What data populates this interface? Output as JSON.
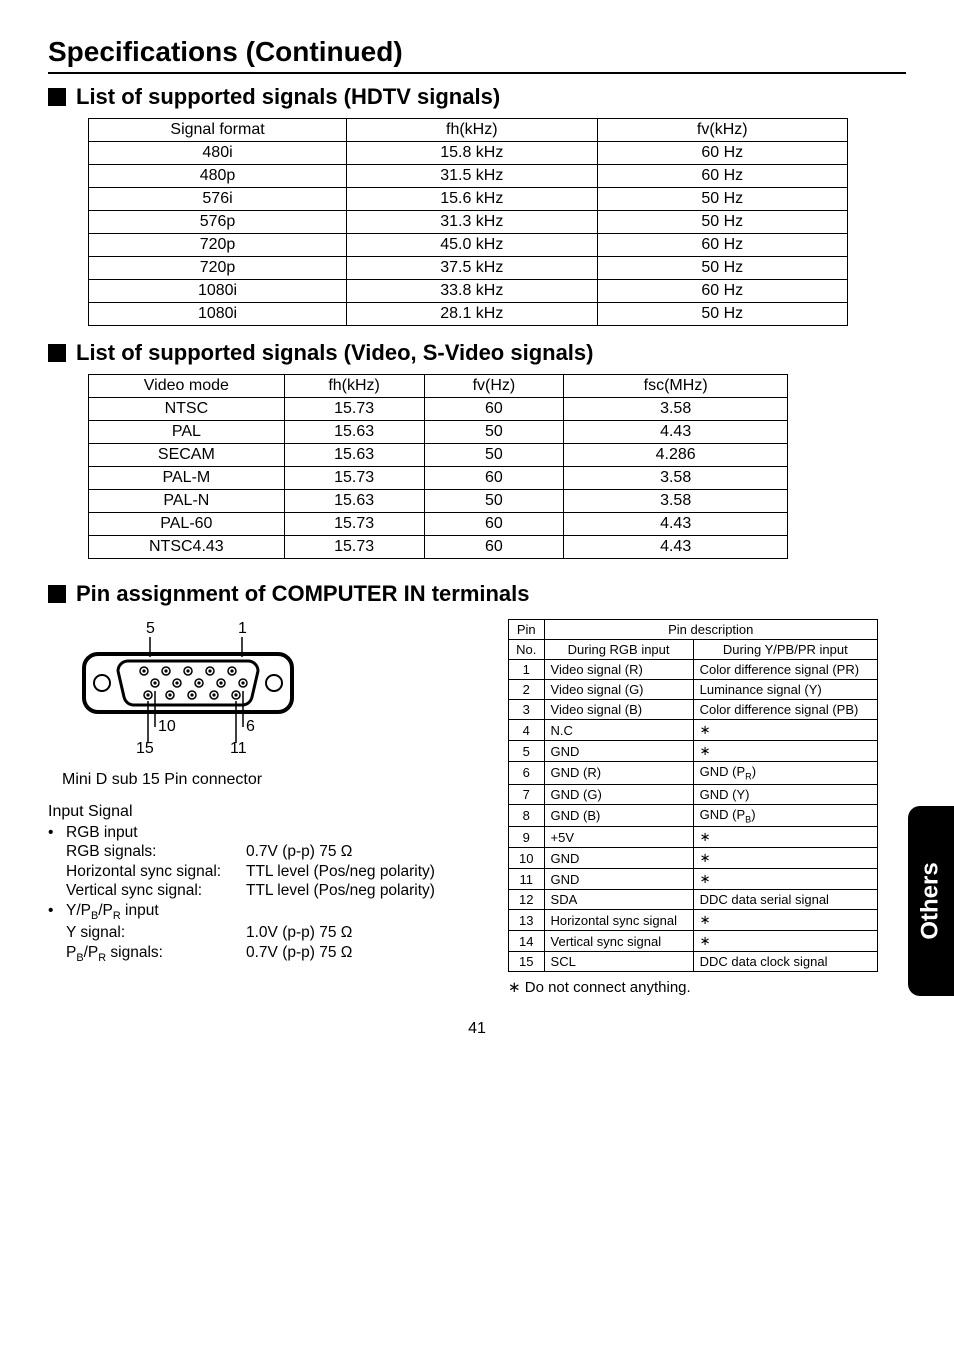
{
  "title": "Specifications (Continued)",
  "sections": {
    "hdtv": {
      "heading": "List of supported signals (HDTV signals)",
      "headers": [
        "Signal format",
        "fh(kHz)",
        "fv(kHz)"
      ],
      "rows": [
        [
          "480i",
          "15.8 kHz",
          "60 Hz"
        ],
        [
          "480p",
          "31.5 kHz",
          "60 Hz"
        ],
        [
          "576i",
          "15.6 kHz",
          "50 Hz"
        ],
        [
          "576p",
          "31.3 kHz",
          "50 Hz"
        ],
        [
          "720p",
          "45.0 kHz",
          "60 Hz"
        ],
        [
          "720p",
          "37.5 kHz",
          "50 Hz"
        ],
        [
          "1080i",
          "33.8 kHz",
          "60 Hz"
        ],
        [
          "1080i",
          "28.1 kHz",
          "50 Hz"
        ]
      ]
    },
    "video": {
      "heading": "List of supported signals (Video, S-Video signals)",
      "headers": [
        "Video mode",
        "fh(kHz)",
        "fv(Hz)",
        "fsc(MHz)"
      ],
      "rows": [
        [
          "NTSC",
          "15.73",
          "60",
          "3.58"
        ],
        [
          "PAL",
          "15.63",
          "50",
          "4.43"
        ],
        [
          "SECAM",
          "15.63",
          "50",
          "4.286"
        ],
        [
          "PAL-M",
          "15.73",
          "60",
          "3.58"
        ],
        [
          "PAL-N",
          "15.63",
          "50",
          "3.58"
        ],
        [
          "PAL-60",
          "15.73",
          "60",
          "4.43"
        ],
        [
          "NTSC4.43",
          "15.73",
          "60",
          "4.43"
        ]
      ]
    },
    "pin": {
      "heading": "Pin assignment of COMPUTER IN terminals",
      "connector_caption": "Mini D sub 15 Pin connector",
      "labels": {
        "l5": "5",
        "l1": "1",
        "l10": "10",
        "l6": "6",
        "l15": "15",
        "l11": "11"
      },
      "input_signal_head": "Input Signal",
      "rgb_group": "RGB input",
      "rgb_lines": {
        "rgb_k": "RGB signals:",
        "rgb_v": "0.7V (p-p) 75 Ω",
        "hs_k": "Horizontal sync signal:",
        "hs_v": "TTL level (Pos/neg polarity)",
        "vs_k": "Vertical sync signal:",
        "vs_v": "TTL level (Pos/neg polarity)"
      },
      "ypbpr_group_plain": "Y/P",
      "ypbpr_group_sub1": "B",
      "ypbpr_group_mid": "/P",
      "ypbpr_group_sub2": "R",
      "ypbpr_group_tail": " input",
      "ypbpr_lines": {
        "y_k": "Y signal:",
        "y_v": "1.0V (p-p) 75 Ω",
        "p_k_pre": "P",
        "p_k_sub1": "B",
        "p_k_mid": "/P",
        "p_k_sub2": "R",
        "p_k_post": " signals:",
        "p_v": "0.7V (p-p) 75 Ω"
      },
      "pin_table": {
        "h_pin": "Pin",
        "h_no": "No.",
        "h_desc": "Pin description",
        "h_rgb": "During RGB input",
        "h_ypbpr": "During Y/PB/PR input",
        "rows": [
          {
            "n": "1",
            "a": "Video signal (R)",
            "b": "Color difference signal (PR)",
            "b_html": false
          },
          {
            "n": "2",
            "a": "Video signal (G)",
            "b": "Luminance signal (Y)",
            "b_html": false
          },
          {
            "n": "3",
            "a": "Video signal (B)",
            "b": "Color difference signal (PB)",
            "b_html": false
          },
          {
            "n": "4",
            "a": "N.C",
            "b": "∗",
            "b_html": false
          },
          {
            "n": "5",
            "a": "GND",
            "b": "∗",
            "b_html": false
          },
          {
            "n": "6",
            "a": "GND (R)",
            "b": "GND (P<sub>R</sub>)",
            "b_html": true
          },
          {
            "n": "7",
            "a": "GND (G)",
            "b": "GND (Y)",
            "b_html": false
          },
          {
            "n": "8",
            "a": "GND (B)",
            "b": "GND (P<sub>B</sub>)",
            "b_html": true
          },
          {
            "n": "9",
            "a": "+5V",
            "b": "∗",
            "b_html": false
          },
          {
            "n": "10",
            "a": "GND",
            "b": "∗",
            "b_html": false
          },
          {
            "n": "11",
            "a": "GND",
            "b": "∗",
            "b_html": false
          },
          {
            "n": "12",
            "a": "SDA",
            "b": "DDC data serial signal",
            "b_html": false
          },
          {
            "n": "13",
            "a": "Horizontal sync signal",
            "b": "∗",
            "b_html": false
          },
          {
            "n": "14",
            "a": "Vertical sync signal",
            "b": "∗",
            "b_html": false
          },
          {
            "n": "15",
            "a": "SCL",
            "b": "DDC data clock signal",
            "b_html": false
          }
        ]
      },
      "footnote": "∗ Do not connect anything."
    }
  },
  "side_tab": "Others",
  "page_number": "41",
  "chart_data": [
    {
      "type": "table",
      "title": "List of supported signals (HDTV signals)",
      "columns": [
        "Signal format",
        "fh(kHz)",
        "fv(kHz)"
      ],
      "rows": [
        [
          "480i",
          15.8,
          60
        ],
        [
          "480p",
          31.5,
          60
        ],
        [
          "576i",
          15.6,
          50
        ],
        [
          "576p",
          31.3,
          50
        ],
        [
          "720p",
          45.0,
          60
        ],
        [
          "720p",
          37.5,
          50
        ],
        [
          "1080i",
          33.8,
          60
        ],
        [
          "1080i",
          28.1,
          50
        ]
      ]
    },
    {
      "type": "table",
      "title": "List of supported signals (Video, S-Video signals)",
      "columns": [
        "Video mode",
        "fh(kHz)",
        "fv(Hz)",
        "fsc(MHz)"
      ],
      "rows": [
        [
          "NTSC",
          15.73,
          60,
          3.58
        ],
        [
          "PAL",
          15.63,
          50,
          4.43
        ],
        [
          "SECAM",
          15.63,
          50,
          4.286
        ],
        [
          "PAL-M",
          15.73,
          60,
          3.58
        ],
        [
          "PAL-N",
          15.63,
          50,
          3.58
        ],
        [
          "PAL-60",
          15.73,
          60,
          4.43
        ],
        [
          "NTSC4.43",
          15.73,
          60,
          4.43
        ]
      ]
    },
    {
      "type": "table",
      "title": "Pin assignment of COMPUTER IN terminals",
      "columns": [
        "Pin No.",
        "During RGB input",
        "During Y/PB/PR input"
      ],
      "rows": [
        [
          1,
          "Video signal (R)",
          "Color difference signal (PR)"
        ],
        [
          2,
          "Video signal (G)",
          "Luminance signal (Y)"
        ],
        [
          3,
          "Video signal (B)",
          "Color difference signal (PB)"
        ],
        [
          4,
          "N.C",
          "*"
        ],
        [
          5,
          "GND",
          "*"
        ],
        [
          6,
          "GND (R)",
          "GND (PR)"
        ],
        [
          7,
          "GND (G)",
          "GND (Y)"
        ],
        [
          8,
          "GND (B)",
          "GND (PB)"
        ],
        [
          9,
          "+5V",
          "*"
        ],
        [
          10,
          "GND",
          "*"
        ],
        [
          11,
          "GND",
          "*"
        ],
        [
          12,
          "SDA",
          "DDC data serial signal"
        ],
        [
          13,
          "Horizontal sync signal",
          "*"
        ],
        [
          14,
          "Vertical sync signal",
          "*"
        ],
        [
          15,
          "SCL",
          "DDC data clock signal"
        ]
      ]
    }
  ]
}
